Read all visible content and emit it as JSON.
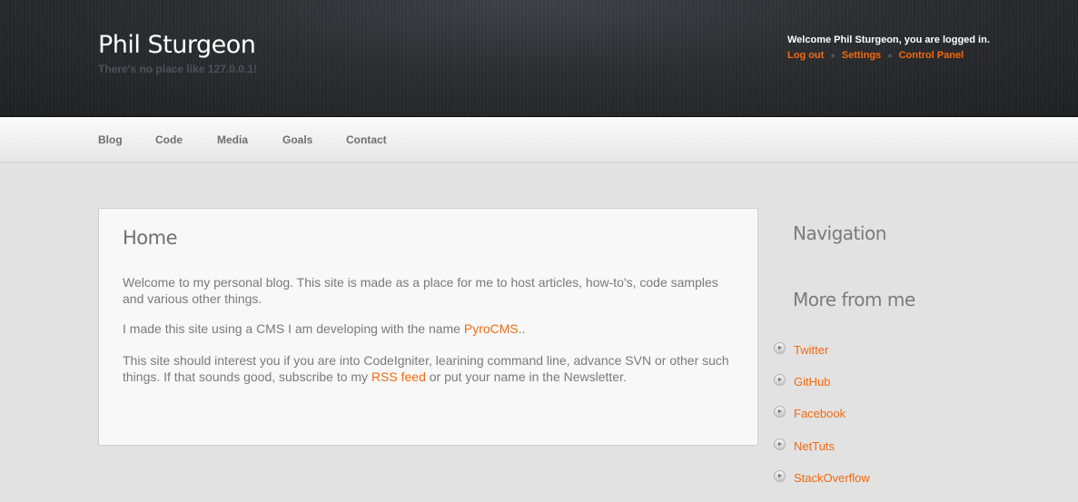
{
  "header": {
    "site_title": "Phil Sturgeon",
    "tagline": "There's no place like 127.0.0.1!",
    "welcome": "Welcome Phil Sturgeon, you are logged in.",
    "user_links": [
      "Log out",
      "Settings",
      "Control Panel"
    ]
  },
  "nav": [
    "Blog",
    "Code",
    "Media",
    "Goals",
    "Contact"
  ],
  "main": {
    "title": "Home",
    "p1": "Welcome to my personal blog. This site is made as a place for me to host articles, how-to's, code samples and various other things.",
    "p2_before": "I made this site using a CMS I am developing with the name ",
    "p2_link": "PyroCMS",
    "p2_after": "..",
    "p3_before": "This site should interest you if you are into CodeIgniter, learining command line, advance SVN or other such things. If that sounds good, subscribe to my ",
    "p3_link": "RSS feed",
    "p3_after": " or put your name in the Newsletter."
  },
  "sidebar": {
    "navigation_heading": "Navigation",
    "more_heading": "More from me",
    "links": [
      "Twitter",
      "GitHub",
      "Facebook",
      "NetTuts",
      "StackOverflow"
    ]
  },
  "colors": {
    "accent": "#f26a10",
    "header_bg": "#2b2d31",
    "page_bg": "#e2e2e2"
  }
}
